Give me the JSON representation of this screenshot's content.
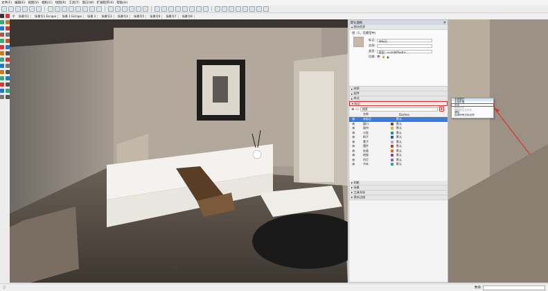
{
  "menubar": [
    "文件(F)",
    "编辑(E)",
    "视图(V)",
    "相机(C)",
    "绘图(R)",
    "工具(T)",
    "窗口(W)",
    "扩展程序(X)",
    "帮助(H)"
  ],
  "scenes": [
    "场景号1",
    "场景号1 Escape",
    "场景 1 Escape",
    "场景 2",
    "场景号3",
    "场景号4",
    "场景号5",
    "场景号6",
    "场景号7",
    "场景号8"
  ],
  "tray": {
    "title": "默认面板",
    "entity_section": "图元信息",
    "entity_header": "组（1，在模型中）",
    "tag_label": "标记:",
    "tag_value": "未标记",
    "instance_label": "实例:",
    "type_label": "类型:",
    "type_value": "类型：<undefined>",
    "toggles_label": "切换:",
    "sections_mid": [
      "材质",
      "组件",
      "样式"
    ],
    "tags_section": "标记",
    "search_placeholder": "搜索",
    "columns": {
      "name": "名称",
      "dashes": "Dashes"
    },
    "tags": [
      {
        "name": "未标记",
        "dash": "默认",
        "color": "#3d7bd9",
        "selected": true
      },
      {
        "name": "窗口",
        "dash": "默认",
        "color": "#7a4a2a"
      },
      {
        "name": "窗帘",
        "dash": "默认",
        "color": "#d4b04a"
      },
      {
        "name": "沙发",
        "dash": "默认",
        "color": "#2f8fa8"
      },
      {
        "name": "椅子",
        "dash": "默认",
        "color": "#2a5f9a"
      },
      {
        "name": "凳子",
        "dash": "默认",
        "color": "#c9a0c8"
      },
      {
        "name": "摆件",
        "dash": "默认",
        "color": "#b04a1f"
      },
      {
        "name": "挂画",
        "dash": "默认",
        "color": "#e06a2a"
      },
      {
        "name": "地毯",
        "dash": "默认",
        "color": "#7b4bb3"
      },
      {
        "name": "吊灯",
        "dash": "默认",
        "color": "#8a66c9"
      },
      {
        "name": "书本",
        "dash": "默认",
        "color": "#2aa89a"
      }
    ],
    "sections_bottom": [
      "阴影",
      "场景",
      "工具向导",
      "柔化边线"
    ]
  },
  "context_menu": [
    {
      "label": "全部展开",
      "state": "hl"
    },
    {
      "label": "全部折叠",
      "state": "normal"
    },
    {
      "label": "全选",
      "state": "red"
    },
    {
      "label": "删除标记",
      "state": "dis"
    },
    {
      "label": "删除标记文件夹",
      "state": "dis"
    },
    {
      "label": "清除",
      "state": "normal"
    },
    {
      "label": "选择所有已标记项",
      "state": "normal"
    }
  ],
  "status": {
    "measure_label": "数值"
  },
  "colors": {
    "accent": "#3d7bd9",
    "highlight": "#e03030"
  }
}
